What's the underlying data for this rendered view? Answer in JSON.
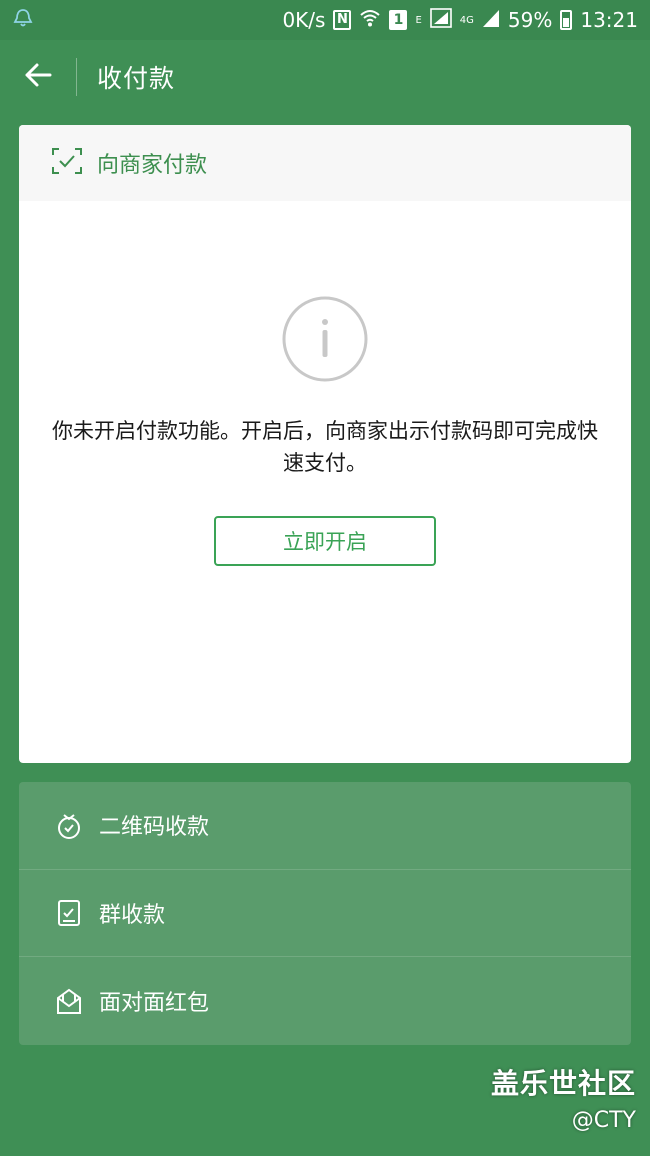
{
  "status_bar": {
    "network_speed": "0K/s",
    "nfc_label": "N",
    "sim_label": "1",
    "signal_type_1": "E",
    "signal_type_2": "4G",
    "battery": "59%",
    "time": "13:21",
    "icons": [
      "notification-icon",
      "nfc-icon",
      "wifi-icon",
      "sim-icon",
      "signal-icon",
      "battery-icon"
    ]
  },
  "header": {
    "title": "收付款",
    "back_icon": "back-arrow-icon"
  },
  "card": {
    "header_title": "向商家付款",
    "header_icon": "scan-check-icon",
    "info_icon": "info-icon",
    "message": "你未开启付款功能。开启后，向商家出示付款码即可完成快速支付。",
    "enable_button": "立即开启"
  },
  "options": [
    {
      "label": "二维码收款",
      "icon": "money-bag-icon"
    },
    {
      "label": "群收款",
      "icon": "group-bill-icon"
    },
    {
      "label": "面对面红包",
      "icon": "red-envelope-icon"
    }
  ],
  "watermark": {
    "title": "盖乐世社区",
    "handle": "@CTY"
  },
  "colors": {
    "background": "#3f8f55",
    "accent_green": "#3aa356",
    "options_panel": "#5a9c6c",
    "card": "#ffffff"
  }
}
